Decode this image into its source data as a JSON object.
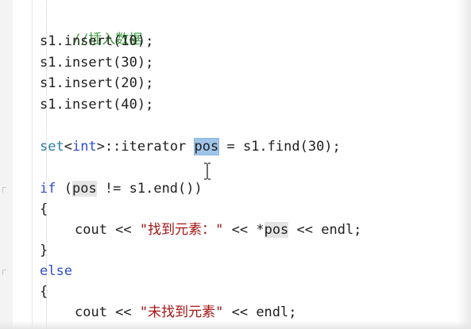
{
  "editor": {
    "lines": [
      "//插入数据",
      "s1.insert(10);",
      "s1.insert(30);",
      "s1.insert(20);",
      "s1.insert(40);",
      "",
      "set<int>::iterator pos = s1.find(30);",
      "",
      "if (pos != s1.end())",
      "{",
      "cout << \"找到元素：\" << *pos << endl;",
      "}",
      "else",
      "{",
      "cout << \"未找到元素\" << endl;"
    ],
    "tokens": {
      "comment": "//插入数据",
      "s1_insert": "s1.insert(",
      "args": [
        "10",
        "30",
        "20",
        "40"
      ],
      "close": ");",
      "set": "set",
      "int": "int",
      "lt": "<",
      "gt": ">",
      "iter": "::iterator ",
      "pos": "pos",
      "assign": " = s1.find(30);",
      "if": "if",
      "if_open": " (",
      "ne_end": " != s1.end())",
      "brace_open": "{",
      "brace_close": "}",
      "cout": "cout << ",
      "found_str": "\"找到元素：\"",
      "shift": " << ",
      "star": "*",
      "endl": " << endl;",
      "else": "else",
      "notfound_str": "\"未找到元素\"",
      "endl2": " << endl;"
    },
    "selected_token": "pos",
    "colors": {
      "comment": "#3f9a3f",
      "keyword": "#2f4fd0",
      "type": "#2b7fa6",
      "string": "#a31515",
      "selection": "#9fc4e8",
      "reference_highlight": "#e4e4e4"
    }
  }
}
